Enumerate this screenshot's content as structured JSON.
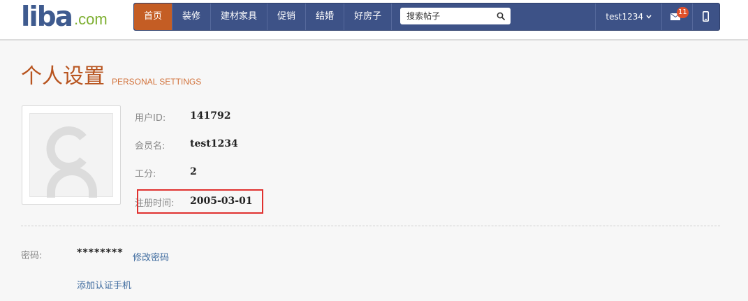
{
  "header": {
    "logo": {
      "main": "liba",
      "suffix": ".com"
    },
    "nav": [
      {
        "label": "首页",
        "active": true
      },
      {
        "label": "装修",
        "active": false
      },
      {
        "label": "建材家具",
        "active": false
      },
      {
        "label": "促销",
        "active": false
      },
      {
        "label": "结婚",
        "active": false
      },
      {
        "label": "好房子",
        "active": false
      }
    ],
    "search": {
      "placeholder": "搜索帖子"
    },
    "user": {
      "name": "test1234"
    },
    "messages": {
      "count": "11"
    }
  },
  "page": {
    "title": "个人设置",
    "title_en": "PERSONAL SETTINGS"
  },
  "profile": {
    "user_id": {
      "label": "用户ID:",
      "value": "141792"
    },
    "username": {
      "label": "会员名:",
      "value": "test1234"
    },
    "points": {
      "label": "工分:",
      "value": "2"
    },
    "register_date": {
      "label": "注册时间:",
      "value": "2005-03-01"
    }
  },
  "security": {
    "password": {
      "label": "密码:",
      "value": "********",
      "change_link": "修改密码"
    },
    "add_phone_link": "添加认证手机"
  },
  "colors": {
    "nav_bg": "#3d5287",
    "nav_active": "#c45d24",
    "title": "#b8541f",
    "link": "#3d6a9e",
    "highlight": "#e0312f"
  }
}
